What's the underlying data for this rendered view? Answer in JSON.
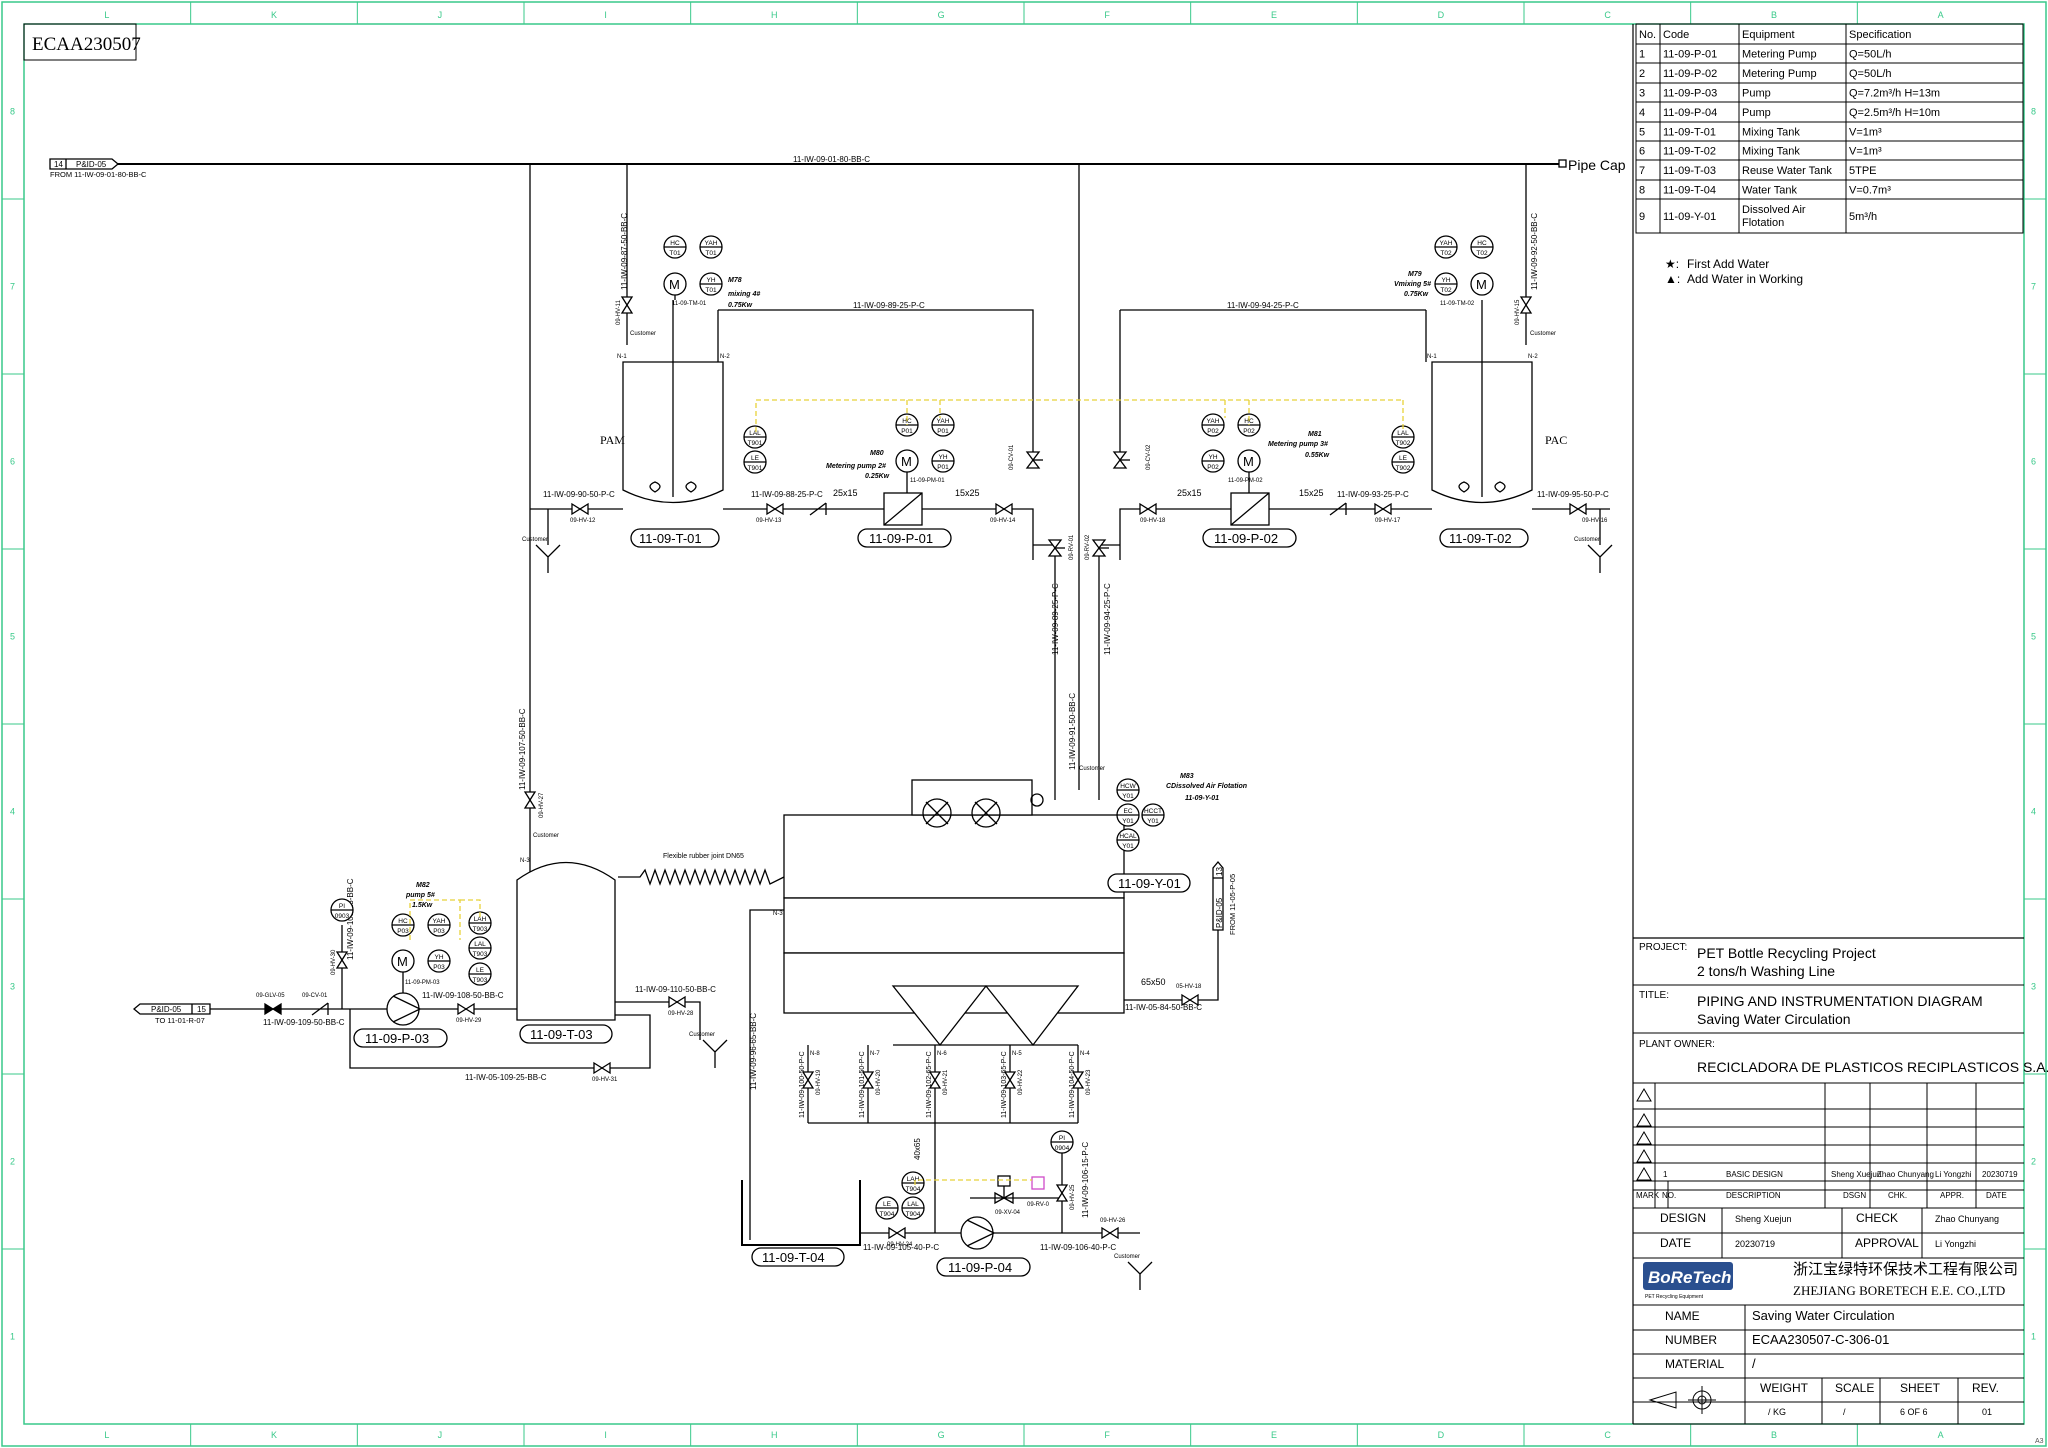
{
  "drawing_id": "ECAA230507",
  "frame": {
    "col_letters": [
      "L",
      "K",
      "J",
      "I",
      "H",
      "G",
      "F",
      "E",
      "D",
      "C",
      "B",
      "A"
    ],
    "row_numbers": [
      "8",
      "7",
      "6",
      "5",
      "4",
      "3",
      "2",
      "1"
    ],
    "corner_mark": "A3"
  },
  "equipment_table": {
    "headers": [
      "No.",
      "Code",
      "Equipment",
      "Specification"
    ],
    "rows": [
      [
        "1",
        "11-09-P-01",
        "Metering Pump",
        "Q=50L/h"
      ],
      [
        "2",
        "11-09-P-02",
        "Metering Pump",
        "Q=50L/h"
      ],
      [
        "3",
        "11-09-P-03",
        "Pump",
        "Q=7.2m³/h H=13m"
      ],
      [
        "4",
        "11-09-P-04",
        "Pump",
        "Q=2.5m³/h H=10m"
      ],
      [
        "5",
        "11-09-T-01",
        "Mixing Tank",
        "V=1m³"
      ],
      [
        "6",
        "11-09-T-02",
        "Mixing Tank",
        "V=1m³"
      ],
      [
        "7",
        "11-09-T-03",
        "Reuse Water Tank",
        "5TPE"
      ],
      [
        "8",
        "11-09-T-04",
        "Water Tank",
        "V=0.7m³"
      ],
      [
        "9",
        "11-09-Y-01",
        "Dissolved Air Flotation",
        "5m³/h"
      ]
    ]
  },
  "legend": {
    "first_add": "First Add Water",
    "add_working": "Add Water in Working"
  },
  "title_block": {
    "project_label": "PROJECT:",
    "project_line1": "PET Bottle Recycling Project",
    "project_line2": "2 tons/h Washing Line",
    "title_label": "TITLE:",
    "title_line1": "PIPING AND INSTRUMENTATION DIAGRAM",
    "title_line2": "Saving Water Circulation",
    "owner_label": "PLANT OWNER:",
    "owner": "RECICLADORA DE PLASTICOS RECIPLASTICOS S.A.",
    "rev_row": [
      "1",
      "BASIC DESIGN",
      "Sheng Xuejun",
      "Zhao Chunyang",
      "Li Yongzhi",
      "20230719"
    ],
    "rev_headers": [
      "MARK",
      "NO.",
      "DESCRIPTION",
      "DSGN",
      "CHK.",
      "APPR.",
      "DATE"
    ],
    "design_label": "DESIGN",
    "design_value": "Sheng Xuejun",
    "check_label": "CHECK",
    "check_value": "Zhao Chunyang",
    "date_label": "DATE",
    "date_value": "20230719",
    "approval_label": "APPROVAL",
    "approval_value": "Li Yongzhi",
    "logo_text": "BoReTech",
    "logo_sub": "PET Recycling Equipment",
    "company_cn": "浙江宝绿特环保技术工程有限公司",
    "company_en": "ZHEJIANG BORETECH E.E. CO.,LTD",
    "name_label": "NAME",
    "name_value": "Saving Water Circulation",
    "number_label": "NUMBER",
    "number_value": "ECAA230507-C-306-01",
    "material_label": "MATERIAL",
    "material_value": "/",
    "weight_label": "WEIGHT",
    "weight_value": "/  KG",
    "scale_label": "SCALE",
    "scale_value": "/",
    "sheet_label": "SHEET",
    "sheet_value": "6 OF 6",
    "rev_label": "REV.",
    "rev_value": "01"
  },
  "diagram": {
    "header_line": "11-IW-09-01-80-BB-C",
    "pipe_cap": "Pipe Cap",
    "pid_in": {
      "num": "14",
      "ref": "P&ID-05",
      "from": "FROM 11-IW-09-01-80-BB-C"
    },
    "pid_out": {
      "num": "15",
      "ref": "P&ID-05",
      "to": "TO 11-01-R-07"
    },
    "pid_right": {
      "num": "13",
      "ref": "P&ID-05",
      "from": "FROM 11-05-P-05"
    },
    "tags": {
      "t01": "11-09-T-01",
      "t02": "11-09-T-02",
      "t03": "11-09-T-03",
      "t04": "11-09-T-04",
      "p01": "11-09-P-01",
      "p02": "11-09-P-02",
      "p03": "11-09-P-03",
      "p04": "11-09-P-04",
      "y01": "11-09-Y-01",
      "pam": "PAM",
      "pac": "PAC"
    },
    "lines": {
      "l87": "11-IW-09-87-50-BB-C",
      "l92": "11-IW-09-92-50-BB-C",
      "l89": "11-IW-09-89-25-P-C",
      "l94": "11-IW-09-94-25-P-C",
      "l90": "11-IW-09-90-50-P-C",
      "l88": "11-IW-09-88-25-P-C",
      "l93": "11-IW-09-93-25-P-C",
      "l95": "11-IW-09-95-50-P-C",
      "l89v": "11-IW-09-89-25-P-C",
      "l94v": "11-IW-09-94-25-P-C",
      "l91": "11-IW-09-91-50-BB-C",
      "l107": "11-IW-09-107-50-BB-C",
      "l109": "11-IW-09-109-15-BB-C",
      "l109b": "11-IW-09-109-50-BB-C",
      "l108": "11-IW-09-108-50-BB-C",
      "l110": "11-IW-09-110-50-BB-C",
      "l05_109": "11-IW-05-109-25-BB-C",
      "l96": "11-IW-09-96-65-BB-C",
      "l05_84": "11-IW-05-84-50-BB-C",
      "l100": "11-IW-09-100-50-P-C",
      "l101": "11-IW-09-101-50-P-C",
      "l102": "11-IW-09-102-65-P-C",
      "l103": "11-IW-09-103-65-P-C",
      "l104": "11-IW-09-104-50-P-C",
      "l105": "11-IW-09-105-40-P-C",
      "l106": "11-IW-09-106-40-P-C",
      "l106b": "11-IW-09-106-15-P-C"
    },
    "valves": {
      "hv11": "09-HV-11",
      "hv15": "09-HV-15",
      "hv12": "09-HV-12",
      "hv13": "09-HV-13",
      "hv14": "09-HV-14",
      "hv16": "09-HV-16",
      "hv17": "09-HV-17",
      "hv18": "09-HV-18",
      "hv27": "09-HV-27",
      "hv28": "09-HV-28",
      "hv29": "09-HV-29",
      "hv31": "09-HV-31",
      "hv30": "09-HV-30",
      "hv19": "09-HV-19",
      "hv20": "09-HV-20",
      "hv21": "09-HV-21",
      "hv22": "09-HV-22",
      "hv23": "09-HV-23",
      "hv24": "09-HV-24",
      "hv26": "09-HV-26",
      "hv25": "09-HV-25",
      "hv05_18": "05-HV-18",
      "cv01": "09-CV-01",
      "cv02": "09-CV-02",
      "rv01": "09-RV-01",
      "rv02": "09-RV-02",
      "cv03": "09-CV-01",
      "glv05": "09-GLV-05",
      "xv04": "09-XV-04",
      "rv": "09-RV-0"
    },
    "reducers": {
      "r1": "25x15",
      "r2": "15x25",
      "r3": "25x15",
      "r4": "15x25",
      "r5": "65x50",
      "r6": "40x65"
    },
    "motors": {
      "m78a": "M78",
      "m78b": "mixing 4#",
      "m78c": "0.75Kw",
      "m79a": "M79",
      "m79b": "Vmixing 5#",
      "m79c": "0.75Kw",
      "m80a": "M80",
      "m80b": "Metering pump 2#",
      "m80c": "0.25Kw",
      "m81a": "M81",
      "m81b": "Metering pump 3#",
      "m81c": "0.55Kw",
      "m82a": "M82",
      "m82b": "pump 5#",
      "m82c": "1.5Kw",
      "m83a": "M83",
      "m83b": "CDissolved Air Flotation",
      "m83c": "11-09-Y-01",
      "tm01": "11-09-TM-01",
      "tm02": "11-09-TM-02",
      "pm01": "11-09-PM-01",
      "pm02": "11-09-PM-02",
      "pm03": "11-09-PM-03"
    },
    "instr": {
      "hc_t01": [
        "HC",
        "T01"
      ],
      "yah_t01": [
        "YAH",
        "T01"
      ],
      "yh_t01": [
        "YH",
        "T01"
      ],
      "yah_t02": [
        "YAH",
        "T02"
      ],
      "hc_t02": [
        "HC",
        "T02"
      ],
      "yh_t02": [
        "YH",
        "T02"
      ],
      "lal_t901": [
        "LAL",
        "T901"
      ],
      "le_t901": [
        "LE",
        "T901"
      ],
      "lal_t902": [
        "LAL",
        "T902"
      ],
      "le_t902": [
        "LE",
        "T902"
      ],
      "hc_p01": [
        "HC",
        "P01"
      ],
      "yah_p01": [
        "YAH",
        "P01"
      ],
      "yh_p01": [
        "YH",
        "P01"
      ],
      "yah_p02": [
        "YAH",
        "P02"
      ],
      "hc_p02": [
        "HC",
        "P02"
      ],
      "yh_p02": [
        "YH",
        "P02"
      ],
      "pi_0903": [
        "PI",
        "0903"
      ],
      "hc_p03": [
        "HC",
        "P03"
      ],
      "yah_p03": [
        "YAH",
        "P03"
      ],
      "yh_p03": [
        "YH",
        "P03"
      ],
      "lah_t903": [
        "LAH",
        "T903"
      ],
      "lal_t903": [
        "LAL",
        "T903"
      ],
      "le_t903": [
        "LE",
        "T903"
      ],
      "hcw_y01": [
        "HCW",
        "Y01"
      ],
      "ec_y01": [
        "EC",
        "Y01"
      ],
      "hcc_y01": [
        "HCCT",
        "Y01"
      ],
      "hcal_y01": [
        "HCAL",
        "Y01"
      ],
      "pi_0904": [
        "PI",
        "0904"
      ],
      "lah_t904": [
        "LAH",
        "T904"
      ],
      "le_t904": [
        "LE",
        "T904"
      ],
      "lal_t904": [
        "LAL",
        "T904"
      ]
    },
    "misc": {
      "customer": "Customer",
      "flex": "Flexible rubber joint DN65",
      "n1": "N-1",
      "n2": "N-2",
      "n3": "N-3",
      "n4": "N-4",
      "n5": "N-5",
      "n6": "N-6",
      "n7": "N-7",
      "n8": "N-8"
    }
  }
}
